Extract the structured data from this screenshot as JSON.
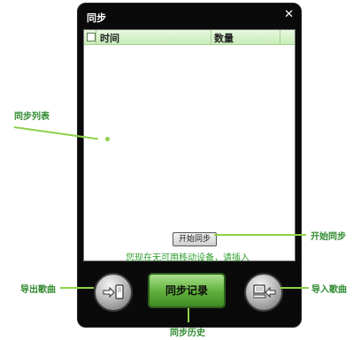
{
  "window": {
    "title": "同步",
    "close_symbol": "✕"
  },
  "list": {
    "columns": [
      "时间",
      "数量"
    ]
  },
  "start_sync_button": "开始同步",
  "status": "您现在无可用移动设备，请插入",
  "bottom": {
    "history_button": "同步记录"
  },
  "annotations": {
    "sync_list": "同步列表",
    "start_sync": "开始同步",
    "export_songs": "导出歌曲",
    "import_songs": "导入歌曲",
    "sync_history": "同步历史"
  },
  "colors": {
    "callout": "#8ed24a",
    "callout_text": "#2f8a2f",
    "status_text": "#2e9e2e",
    "window_bg": "#0a0a0a",
    "history_button": "#5fae3a"
  }
}
